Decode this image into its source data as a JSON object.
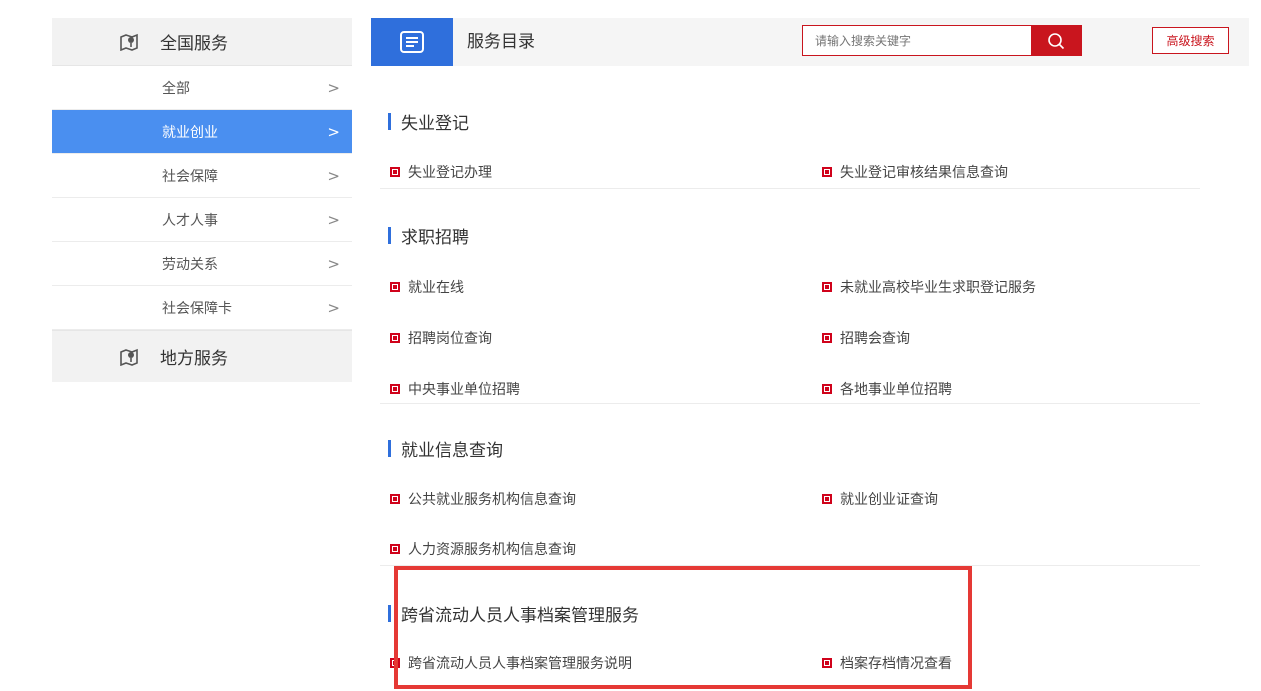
{
  "sidebar": {
    "national_title": "全国服务",
    "local_title": "地方服务",
    "items": [
      {
        "label": "全部",
        "active": false
      },
      {
        "label": "就业创业",
        "active": true
      },
      {
        "label": "社会保障",
        "active": false
      },
      {
        "label": "人才人事",
        "active": false
      },
      {
        "label": "劳动关系",
        "active": false
      },
      {
        "label": "社会保障卡",
        "active": false
      }
    ],
    "chevron": ">"
  },
  "header": {
    "title": "服务目录",
    "search_placeholder": "请输入搜索关键字",
    "advanced_label": "高级搜索"
  },
  "sections": [
    {
      "title": "失业登记",
      "links": [
        "失业登记办理",
        "失业登记审核结果信息查询"
      ]
    },
    {
      "title": "求职招聘",
      "links": [
        "就业在线",
        "未就业高校毕业生求职登记服务",
        "招聘岗位查询",
        "招聘会查询",
        "中央事业单位招聘",
        "各地事业单位招聘"
      ]
    },
    {
      "title": "就业信息查询",
      "links": [
        "公共就业服务机构信息查询",
        "就业创业证查询",
        "人力资源服务机构信息查询"
      ]
    },
    {
      "title": "跨省流动人员人事档案管理服务",
      "links": [
        "跨省流动人员人事档案管理服务说明",
        "档案存档情况查看"
      ]
    }
  ],
  "colors": {
    "accent": "#2f6fdc",
    "active": "#4a8ff0",
    "red": "#c9151e",
    "highlight": "#e53935"
  }
}
